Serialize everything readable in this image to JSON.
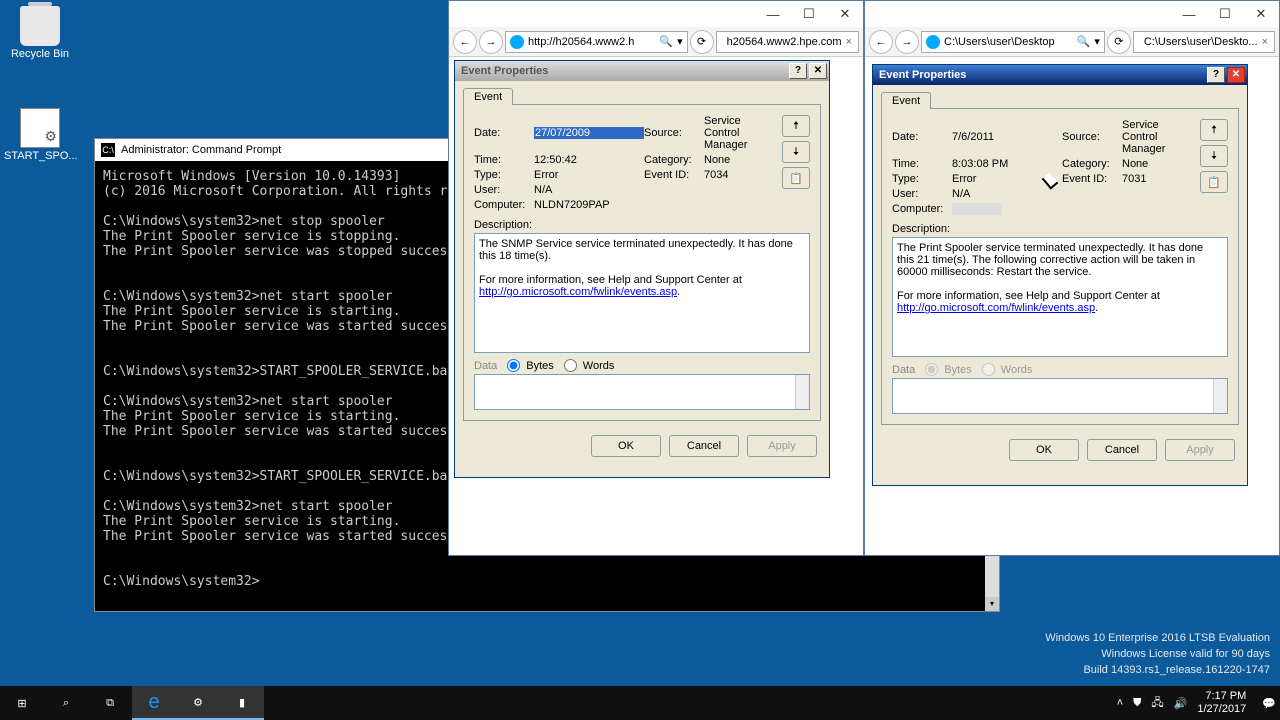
{
  "desktop": {
    "recycle": "Recycle Bin",
    "bat": "START_SPO..."
  },
  "cmd": {
    "title": "Administrator: Command Prompt",
    "body": "Microsoft Windows [Version 10.0.14393]\n(c) 2016 Microsoft Corporation. All rights res\n\nC:\\Windows\\system32>net stop spooler\nThe Print Spooler service is stopping.\nThe Print Spooler service was stopped successful\n\n\nC:\\Windows\\system32>net start spooler\nThe Print Spooler service is starting.\nThe Print Spooler service was started successful\n\n\nC:\\Windows\\system32>START_SPOOLER_SERVICE.bat\n\nC:\\Windows\\system32>net start spooler\nThe Print Spooler service is starting.\nThe Print Spooler service was started successful\n\n\nC:\\Windows\\system32>START_SPOOLER_SERVICE.bat\n\nC:\\Windows\\system32>net start spooler\nThe Print Spooler service is starting.\nThe Print Spooler service was started successful\n\n\nC:\\Windows\\system32>"
  },
  "browser1": {
    "addr": "http://h20564.www2.h",
    "tab": "h20564.www2.hpe.com"
  },
  "browser2": {
    "addr": "C:\\Users\\user\\Desktop",
    "tab": "C:\\Users\\user\\Deskto..."
  },
  "evt1": {
    "title": "Event Properties",
    "tab": "Event",
    "labels": {
      "date": "Date:",
      "time": "Time:",
      "type": "Type:",
      "user": "User:",
      "computer": "Computer:",
      "source": "Source:",
      "category": "Category:",
      "eventid": "Event ID:",
      "desc": "Description:",
      "data": "Data",
      "bytes": "Bytes",
      "words": "Words"
    },
    "vals": {
      "date": "27/07/2009",
      "time": "12:50:42",
      "type": "Error",
      "user": "N/A",
      "computer": "NLDN7209PAP",
      "source": "Service Control Manager",
      "category": "None",
      "eventid": "7034"
    },
    "desc1": "The SNMP Service service terminated unexpectedly.  It has done this 18 time(s).",
    "desc2": "For more information, see Help and Support Center at ",
    "link": "http://go.microsoft.com/fwlink/events.asp",
    "buttons": {
      "ok": "OK",
      "cancel": "Cancel",
      "apply": "Apply"
    }
  },
  "evt2": {
    "title": "Event Properties",
    "tab": "Event",
    "vals": {
      "date": "7/6/2011",
      "time": "8:03:08 PM",
      "type": "Error",
      "user": "N/A",
      "computer": "",
      "source": "Service Control Manager",
      "category": "None",
      "eventid": "7031"
    },
    "desc1": "The Print Spooler service terminated unexpectedly.  It has done this 21 time(s).  The following corrective action will be taken in 60000 milliseconds: Restart the service.",
    "desc2": "For more information, see Help and Support Center at ",
    "link": "http://go.microsoft.com/fwlink/events.asp"
  },
  "wm": {
    "l1": "Windows 10 Enterprise 2016 LTSB Evaluation",
    "l2": "Windows License valid for 90 days",
    "l3": "Build 14393.rs1_release.161220-1747"
  },
  "tray": {
    "time": "7:17 PM",
    "date": "1/27/2017"
  }
}
